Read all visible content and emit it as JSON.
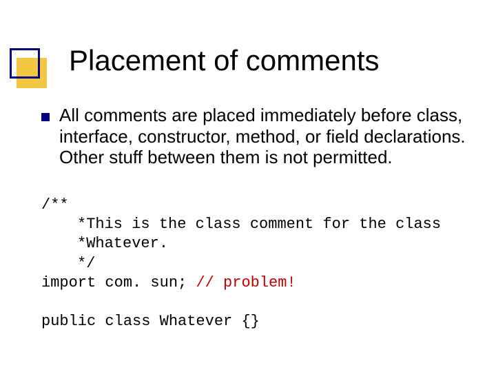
{
  "title": "Placement of comments",
  "body": {
    "bullet": "All comments are placed immediately before class, interface, constructor, method, or field declarations. Other stuff between them is not permitted."
  },
  "code": {
    "l1": "/**",
    "l2": "*This is the class comment for the class",
    "l3": "*Whatever.",
    "l4": "*/",
    "l5a": "import com. sun; ",
    "l5b": "// problem!",
    "l6": "public class Whatever {}"
  }
}
